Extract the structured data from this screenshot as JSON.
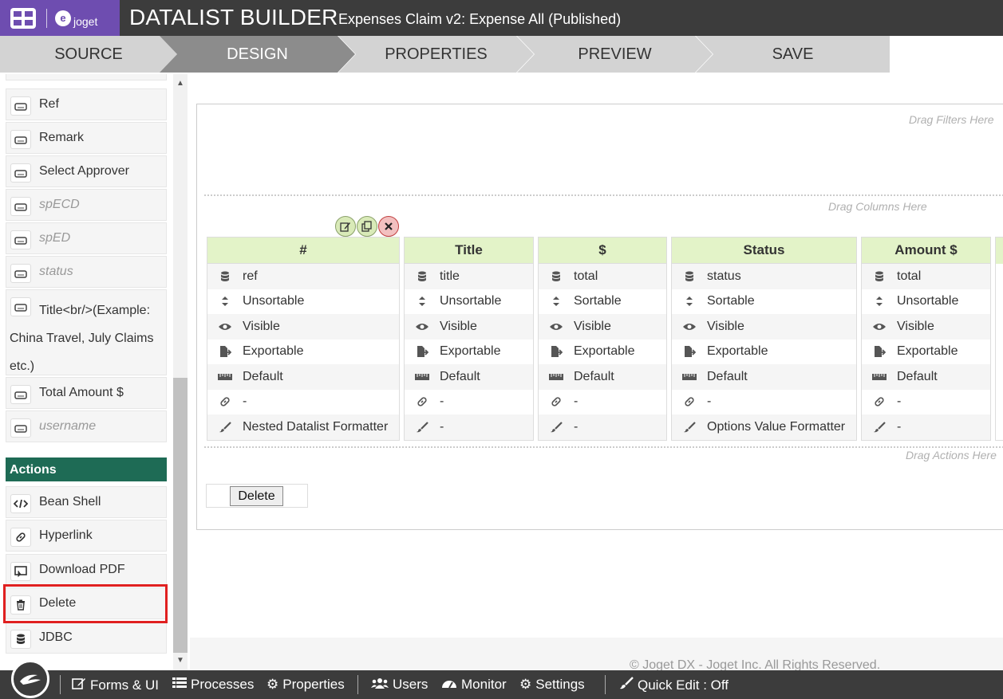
{
  "header": {
    "logo_text": "joget",
    "title": "DATALIST BUILDER",
    "subtitle": "Expenses Claim v2: Expense All (Published)"
  },
  "tabs": [
    {
      "label": "SOURCE"
    },
    {
      "label": "DESIGN"
    },
    {
      "label": "PROPERTIES"
    },
    {
      "label": "PREVIEW"
    },
    {
      "label": "SAVE"
    }
  ],
  "sidebar": {
    "columns": [
      {
        "label": "Ref"
      },
      {
        "label": "Remark"
      },
      {
        "label": "Select Approver"
      },
      {
        "label": "spECD"
      },
      {
        "label": "spED"
      },
      {
        "label": "status"
      },
      {
        "label": "Title<br/>(Example: China Travel, July Claims etc.)"
      },
      {
        "label": "Total Amount $"
      },
      {
        "label": "username"
      }
    ],
    "actions_header": "Actions",
    "actions": [
      {
        "label": "Bean Shell"
      },
      {
        "label": "Hyperlink"
      },
      {
        "label": "Download PDF"
      },
      {
        "label": "Delete"
      },
      {
        "label": "JDBC"
      }
    ]
  },
  "canvas": {
    "drag_filters": "Drag Filters Here",
    "drag_columns": "Drag Columns Here",
    "drag_actions": "Drag Actions Here",
    "columns": [
      {
        "header": "#",
        "field": "ref",
        "sortable": "Unsortable",
        "visible": "Visible",
        "exportable": "Exportable",
        "width": "Default",
        "link": "-",
        "formatter": "Nested Datalist Formatter"
      },
      {
        "header": "Title",
        "field": "title",
        "sortable": "Unsortable",
        "visible": "Visible",
        "exportable": "Exportable",
        "width": "Default",
        "link": "-",
        "formatter": "-"
      },
      {
        "header": "$",
        "field": "total",
        "sortable": "Sortable",
        "visible": "Visible",
        "exportable": "Exportable",
        "width": "Default",
        "link": "-",
        "formatter": "-"
      },
      {
        "header": "Status",
        "field": "status",
        "sortable": "Sortable",
        "visible": "Visible",
        "exportable": "Exportable",
        "width": "Default",
        "link": "-",
        "formatter": "Options Value Formatter"
      },
      {
        "header": "Amount $",
        "field": "total",
        "sortable": "Unsortable",
        "visible": "Visible",
        "exportable": "Exportable",
        "width": "Default",
        "link": "-",
        "formatter": "-"
      }
    ],
    "action_button": "Delete",
    "copyright": "© Joget DX - Joget Inc. All Rights Reserved."
  },
  "bottombar": {
    "items": [
      {
        "label": "Forms & UI"
      },
      {
        "label": "Processes"
      },
      {
        "label": "Properties"
      },
      {
        "label": "Users"
      },
      {
        "label": "Monitor"
      },
      {
        "label": "Settings"
      },
      {
        "label": "Quick Edit : Off"
      }
    ]
  },
  "colors": {
    "brand_purple": "#6e4db0",
    "header_dark": "#3c3c3c",
    "actions_green": "#1e6b55",
    "column_header": "#e3f3c8",
    "highlight_red": "#e02020"
  }
}
